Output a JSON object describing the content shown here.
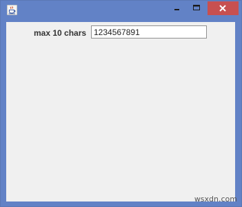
{
  "window": {
    "app_icon": "java-cup-icon",
    "controls": {
      "minimize_icon": "minimize-icon",
      "maximize_icon": "maximize-icon",
      "close_icon": "close-icon",
      "close_color": "#c75050"
    },
    "frame_color": "#6282c6"
  },
  "form": {
    "label": "max 10 chars",
    "input_value": "1234567891"
  },
  "watermark": "wsxdn.com"
}
